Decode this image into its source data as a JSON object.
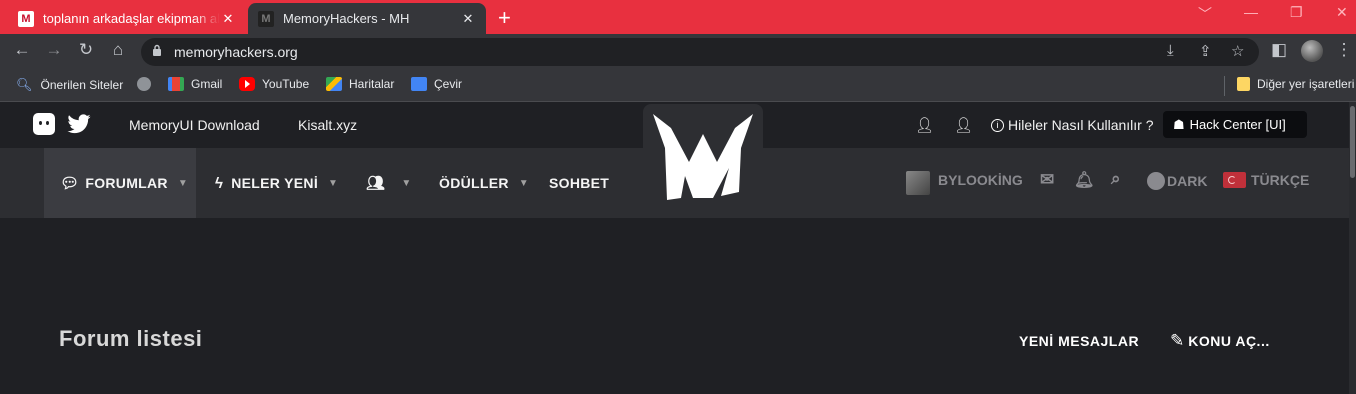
{
  "browser": {
    "tabs": [
      {
        "title": "toplanın arkadaşlar ekipman alırken",
        "favicon": "memoryhackers-favicon",
        "active": false
      },
      {
        "title": "MemoryHackers - MH",
        "favicon": "memoryhackers-favicon",
        "active": true
      }
    ],
    "new_tab": "+",
    "address": "memoryhackers.org",
    "bookmarks": [
      {
        "label": "Önerilen Siteler",
        "icon": "search-icon"
      },
      {
        "label": "",
        "icon": "globe-icon"
      },
      {
        "label": "Gmail",
        "icon": "gmail-icon"
      },
      {
        "label": "YouTube",
        "icon": "youtube-icon"
      },
      {
        "label": "Haritalar",
        "icon": "maps-icon"
      },
      {
        "label": "Çevir",
        "icon": "translate-icon"
      }
    ],
    "other_bookmarks": "Diğer yer işaretleri",
    "colors": {
      "tabbar": "#e8303f",
      "toolbar": "#35363a"
    }
  },
  "site": {
    "top_links": [
      "MemoryUI Download",
      "Kisalt.xyz"
    ],
    "help_link": "Hileler Nasıl Kullanılır ?",
    "hack_center": "Hack Center [UI]",
    "nav": [
      {
        "label": "FORUMLAR",
        "icon": "comments-icon",
        "dropdown": true,
        "active": true
      },
      {
        "label": "NELER YENİ",
        "icon": "bolt-icon",
        "dropdown": true,
        "active": false
      },
      {
        "label": "",
        "icon": "users-icon",
        "dropdown": true,
        "active": false
      },
      {
        "label": "ÖDÜLLER",
        "icon": "",
        "dropdown": true,
        "active": false
      },
      {
        "label": "SOHBET",
        "icon": "",
        "dropdown": false,
        "active": false
      }
    ],
    "user": "BYLOOKİNG",
    "theme": "DARK",
    "language": "TÜRKÇE",
    "page_title": "Forum listesi",
    "actions": {
      "new_posts": "YENİ MESAJLAR",
      "new_thread": "KONU AÇ..."
    },
    "colors": {
      "background": "#1f2024",
      "nav": "#2d2e32"
    }
  }
}
